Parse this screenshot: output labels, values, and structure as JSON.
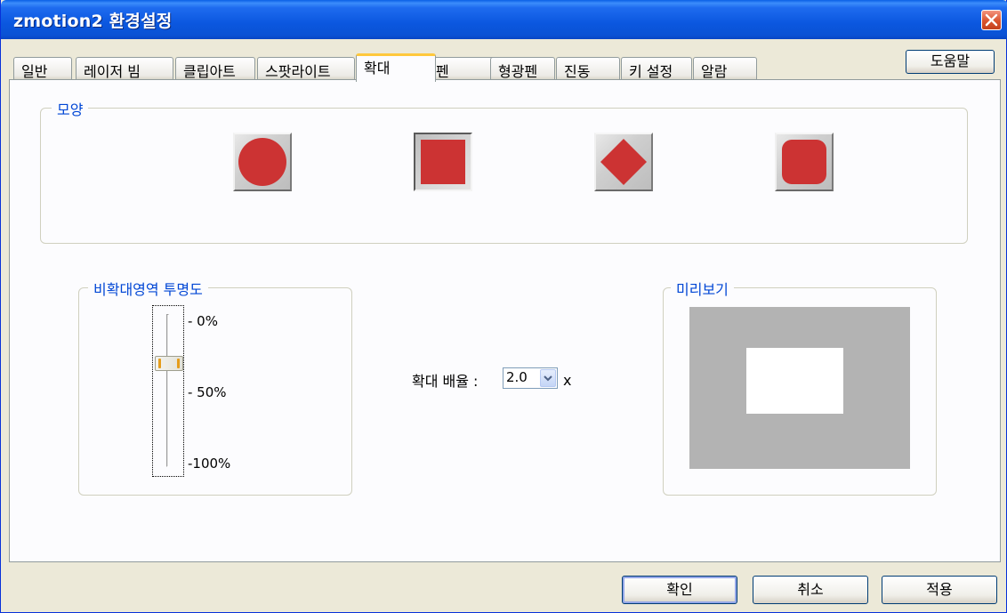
{
  "window": {
    "title": "zmotion2 환경설정"
  },
  "tabs": [
    {
      "label": "일반"
    },
    {
      "label": "레이저 빔"
    },
    {
      "label": "클립아트"
    },
    {
      "label": "스팟라이트"
    },
    {
      "label": "확대",
      "active": true
    },
    {
      "label": "펜"
    },
    {
      "label": "형광펜"
    },
    {
      "label": "진동"
    },
    {
      "label": "키 설정"
    },
    {
      "label": "알람"
    }
  ],
  "help_label": "도움말",
  "shape_group": {
    "label": "모양",
    "shapes": [
      {
        "name": "circle",
        "selected": false
      },
      {
        "name": "square",
        "selected": true
      },
      {
        "name": "diamond",
        "selected": false
      },
      {
        "name": "rounded-square",
        "selected": false
      }
    ],
    "shape_color": "#CC3333"
  },
  "transparency": {
    "label": "비확대영역 투명도",
    "ticks": [
      "- 0%",
      "- 50%",
      "-100%"
    ],
    "value_percent": 30
  },
  "zoom": {
    "label": "확대 배율 :",
    "value": "2.0",
    "unit": "x"
  },
  "preview": {
    "label": "미리보기"
  },
  "buttons": {
    "ok": "확인",
    "cancel": "취소",
    "apply": "적용"
  },
  "colors": {
    "titlebar": "#0A5FE6",
    "group_label": "#0046D5",
    "active_tab_accent": "#FFC83C"
  }
}
